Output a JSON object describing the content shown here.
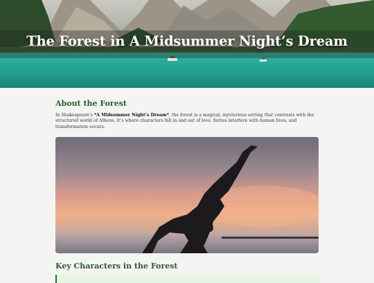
{
  "hero": {
    "title": "The Forest in A Midsummer Night’s Dream"
  },
  "about": {
    "heading": "About the Forest",
    "intro_prefix": "In Shakespeare’s ",
    "play_title": "*A Midsummer Night’s Dream*",
    "intro_rest": ", the forest is a magical, mysterious setting that contrasts with the structured world of Athens. It’s where characters fall in and out of love, fairies interfere with human lives, and transformation occurs."
  },
  "photo": {
    "subject": "silhouette of a person doing a yoga pose at sunset by the sea"
  },
  "characters": {
    "heading": "Key Characters in the Forest"
  },
  "colors": {
    "heading_green": "#2e5a2f",
    "quote_bg": "#e6f4e3",
    "quote_border": "#2e6b2f",
    "page_bg": "#f4f4f2"
  }
}
